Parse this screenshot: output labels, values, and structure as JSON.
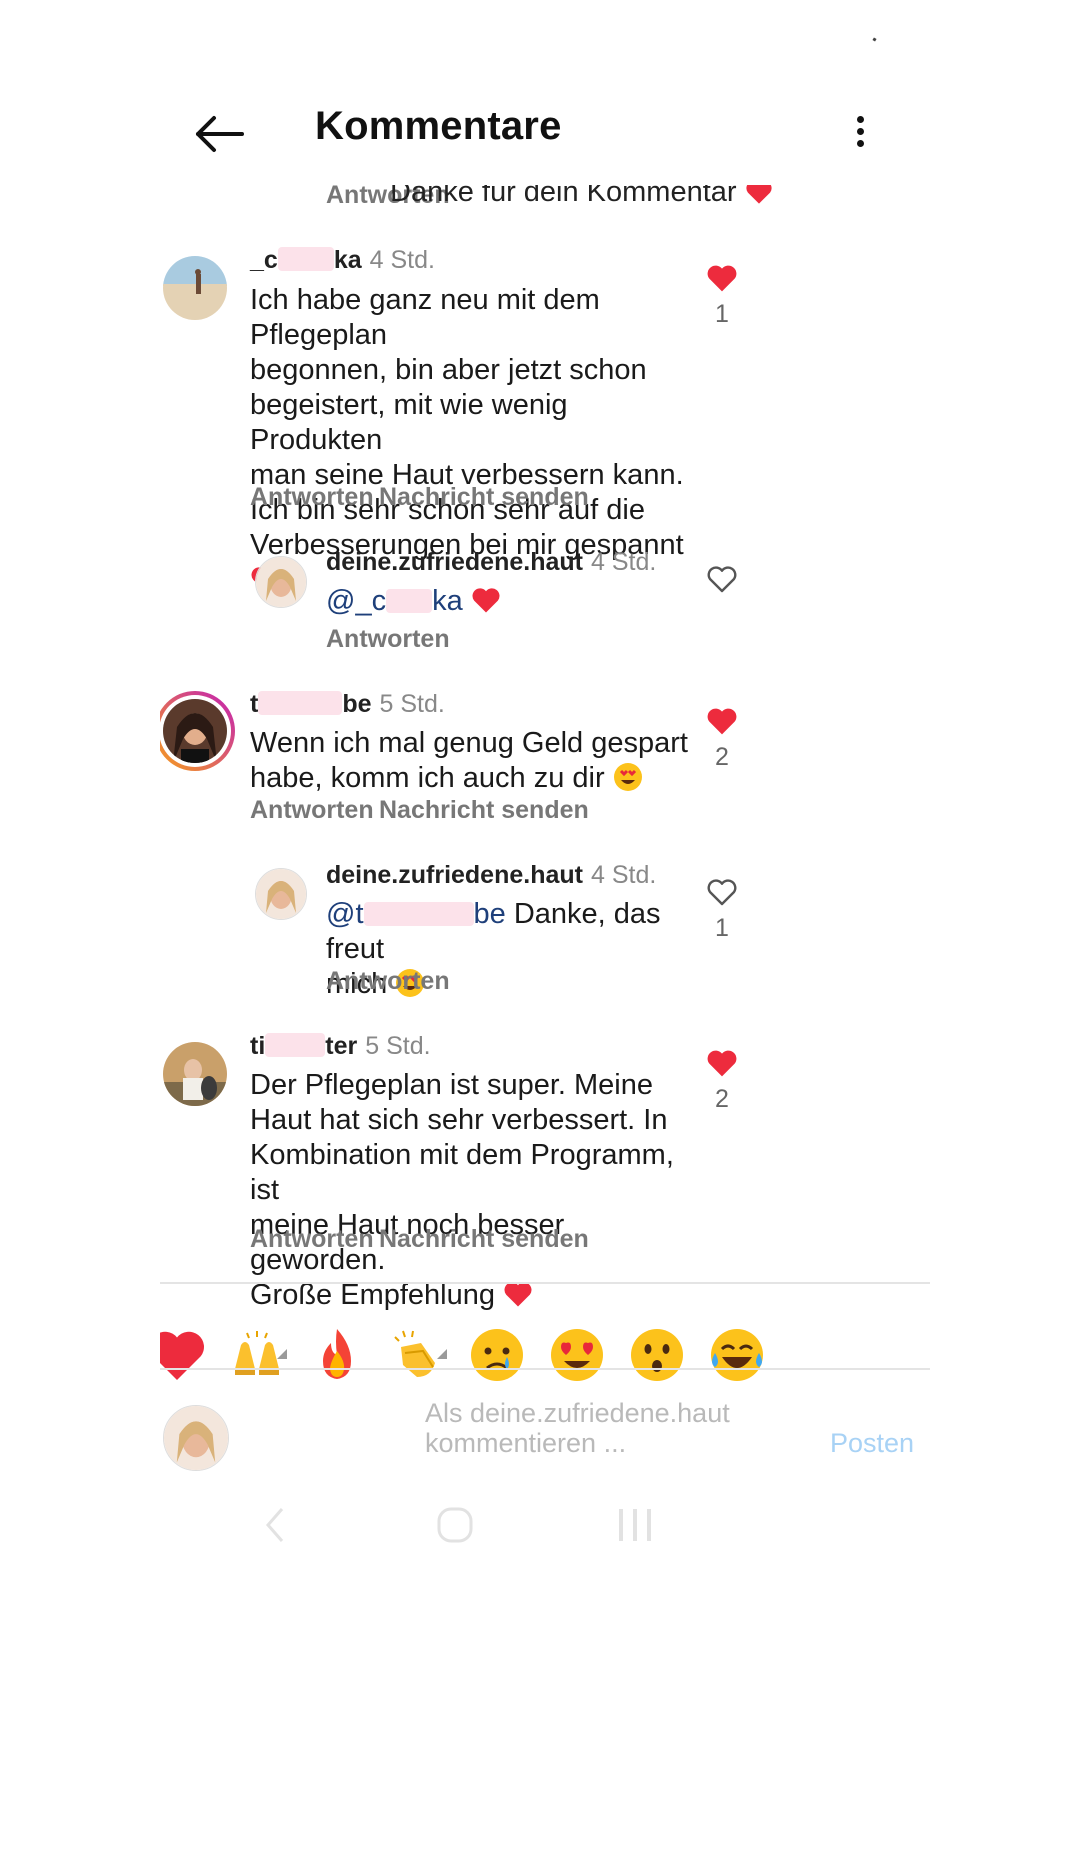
{
  "header": {
    "title": "Kommentare"
  },
  "previous_comment": {
    "text_fragment": "Danke für dein Kommentar",
    "reply_label": "Antworten"
  },
  "comments": [
    {
      "username_prefix": "_c",
      "username_suffix": "ka",
      "time": "4 Std.",
      "lines": [
        "Ich habe ganz neu mit dem Pflegeplan",
        "begonnen, bin aber jetzt schon",
        "begeistert, mit wie wenig Produkten",
        "man seine Haut verbessern kann.",
        "Ich bin sehr schon sehr auf die",
        "Verbesserungen bei mir gespannt"
      ],
      "likes": "1",
      "liked": true,
      "reply_label": "Antworten",
      "message_label": "Nachricht senden"
    },
    {
      "username": "deine.zufriedene.haut",
      "time": "4 Std.",
      "mention_prefix": "@_c",
      "mention_suffix": "ka",
      "reply_label": "Antworten",
      "liked": false
    },
    {
      "username_prefix": "t",
      "username_suffix": "be",
      "time": "5 Std.",
      "lines": [
        "Wenn ich mal genug Geld gespart",
        "habe, komm ich auch zu dir"
      ],
      "likes": "2",
      "liked": true,
      "reply_label": "Antworten",
      "message_label": "Nachricht senden"
    },
    {
      "username": "deine.zufriedene.haut",
      "time": "4 Std.",
      "mention_prefix": "@t",
      "mention_suffix": "be",
      "text_after_mention": "Danke, das freut",
      "line2": "mich",
      "likes": "1",
      "liked": false,
      "reply_label": "Antworten"
    },
    {
      "username_prefix": "ti",
      "username_suffix": "ter",
      "time": "5 Std.",
      "lines": [
        "Der Pflegeplan ist super. Meine",
        "Haut hat sich sehr verbessert. In",
        "Kombination mit dem Programm, ist",
        "meine Haut noch besser geworden.",
        "Große Empfehlung"
      ],
      "likes": "2",
      "liked": true,
      "reply_label": "Antworten",
      "message_label": "Nachricht senden"
    }
  ],
  "emoji_bar": [
    "heart",
    "raising-hands",
    "fire",
    "clapping-hands",
    "crying-face",
    "heart-eyes",
    "astonished-face",
    "tears-of-joy"
  ],
  "composer": {
    "placeholder_line1": "Als deine.zufriedene.haut",
    "placeholder_line2": "kommentieren ...",
    "post_label": "Posten"
  },
  "colors": {
    "heart": "#ed2b3d",
    "post": "#a8d2f5",
    "mention": "#1e3f7a",
    "story_ring": [
      "#f7a11a",
      "#c21eb7"
    ]
  }
}
